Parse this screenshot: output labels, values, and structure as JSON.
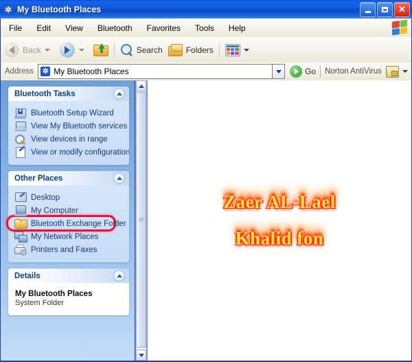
{
  "window": {
    "title": "My Bluetooth Places",
    "icon": "bluetooth-icon",
    "buttons": {
      "minimize": "Minimize",
      "maximize": "Maximize",
      "close": "Close"
    }
  },
  "menubar": {
    "items": [
      {
        "label": "File",
        "accel": "F"
      },
      {
        "label": "Edit",
        "accel": "E"
      },
      {
        "label": "View",
        "accel": "V"
      },
      {
        "label": "Bluetooth",
        "accel": "B"
      },
      {
        "label": "Favorites",
        "accel": "F"
      },
      {
        "label": "Tools",
        "accel": "T"
      },
      {
        "label": "Help",
        "accel": "H"
      }
    ],
    "brand_icon": "windows-flag-icon"
  },
  "toolbar": {
    "back_label": "Back",
    "forward_label": "",
    "up_label": "",
    "search_label": "Search",
    "folders_label": "Folders",
    "views_label": ""
  },
  "addressbar": {
    "label": "Address",
    "value": "My Bluetooth Places",
    "icon": "bluetooth-icon",
    "go_label": "Go",
    "norton_label": "Norton AntiVirus"
  },
  "sidebar": {
    "panels": [
      {
        "title": "Bluetooth Tasks",
        "items": [
          {
            "label": "Bluetooth Setup Wizard",
            "icon": "bluetooth-wizard-icon"
          },
          {
            "label": "View My Bluetooth services",
            "icon": "laptop-icon"
          },
          {
            "label": "View devices in range",
            "icon": "magnifier-icon",
            "highlighted": true
          },
          {
            "label": "View or modify configuration",
            "icon": "configuration-icon"
          }
        ]
      },
      {
        "title": "Other Places",
        "items": [
          {
            "label": "Desktop",
            "icon": "desktop-icon"
          },
          {
            "label": "My Computer",
            "icon": "my-computer-icon"
          },
          {
            "label": "Bluetooth Exchange Folder",
            "icon": "folder-icon"
          },
          {
            "label": "My Network Places",
            "icon": "network-icon"
          },
          {
            "label": "Printers and Faxes",
            "icon": "printer-icon"
          }
        ]
      }
    ],
    "details": {
      "title": "Details",
      "name": "My Bluetooth Places",
      "type": "System Folder"
    }
  },
  "content": {
    "watermark_line1": "Zaer AL-Lael",
    "watermark_line2": "Khalid fon"
  },
  "colors": {
    "titlebar": "#0f58dd",
    "frame": "#1d3fae",
    "sidebar_top": "#6f9fd8",
    "highlight": "#ee1133",
    "panel_title": "#0b3e86",
    "flame": "#ffdd55"
  }
}
